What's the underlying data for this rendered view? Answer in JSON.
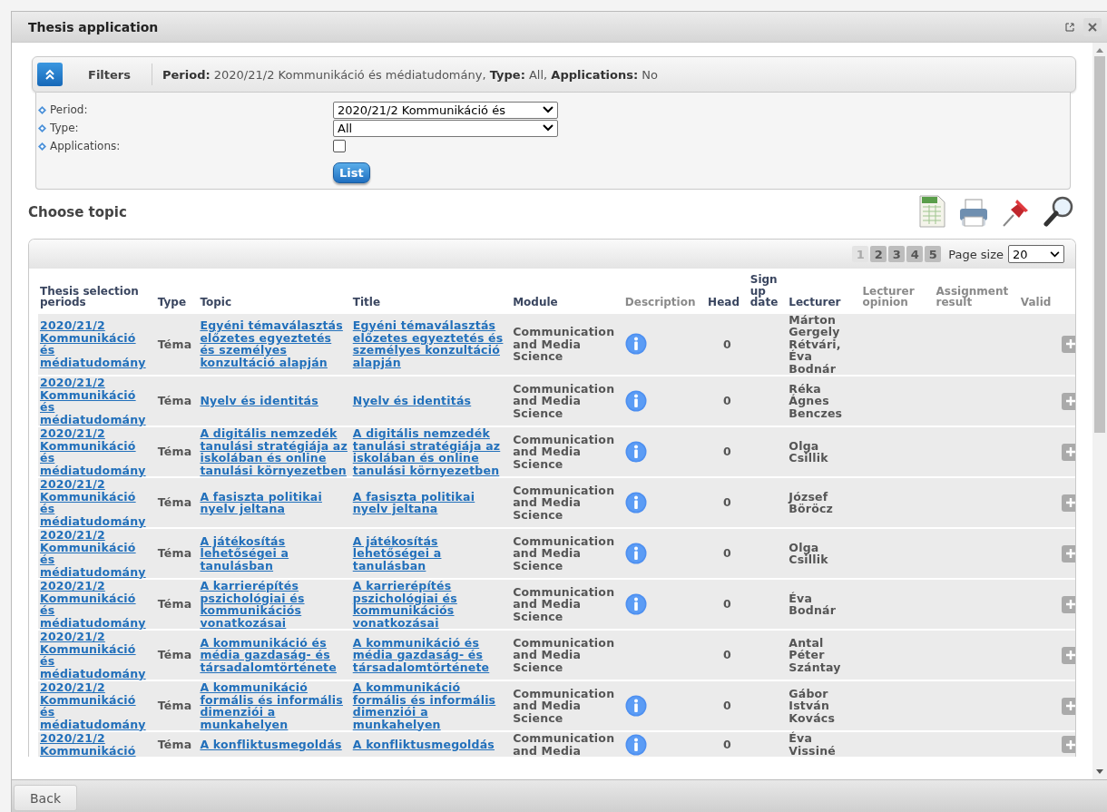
{
  "window": {
    "title": "Thesis application"
  },
  "filters": {
    "label": "Filters",
    "expanded": true,
    "summary": "**Period:** 2020/21/2 Kommunikáció és médiatudomány, **Type:** All, **Applications:** No",
    "fields": [
      {
        "kind": "select",
        "label": "Period:",
        "value": "2020/21/2 Kommunikáció és"
      },
      {
        "kind": "select",
        "label": "Type:",
        "value": "All"
      },
      {
        "kind": "checkbox",
        "label": "Applications:",
        "checked": false
      }
    ],
    "list_button": "List"
  },
  "section_title": "Choose topic",
  "pagination": {
    "pages": [
      {
        "label": "1",
        "selected": true
      },
      {
        "label": "2",
        "selected": false
      },
      {
        "label": "3",
        "selected": false
      },
      {
        "label": "4",
        "selected": false
      },
      {
        "label": "5",
        "selected": false
      }
    ],
    "page_size_label": "Page size",
    "page_size": "20"
  },
  "table": {
    "columns": [
      {
        "label": "Thesis selection periods",
        "muted": false
      },
      {
        "label": "Type",
        "muted": false
      },
      {
        "label": "Topic",
        "muted": false
      },
      {
        "label": "Title",
        "muted": false
      },
      {
        "label": "Module",
        "muted": false
      },
      {
        "label": "Description",
        "muted": true
      },
      {
        "label": "Head",
        "muted": false
      },
      {
        "label": "Sign up date",
        "muted": false
      },
      {
        "label": "Lecturer",
        "muted": false
      },
      {
        "label": "Lecturer opinion",
        "muted": true
      },
      {
        "label": "Assignment result",
        "muted": true
      },
      {
        "label": "Valid",
        "muted": true
      }
    ],
    "rows": [
      {
        "period": "2020/21/2 Kommunikáció és médiatudomány",
        "type": "Téma",
        "topic": "Egyéni témaválasztás előzetes egyeztetés és személyes konzultáció alapján",
        "title": "Egyéni témaválasztás előzetes egyeztetés és személyes konzultáció alapján",
        "module": "Communication and Media Science",
        "description": true,
        "head": "0",
        "lecturer": "Márton Gergely Rétvári, Éva Bodnár"
      },
      {
        "period": "2020/21/2 Kommunikáció és médiatudomány",
        "type": "Téma",
        "topic": "Nyelv és identitás",
        "title": "Nyelv és identitás",
        "module": "Communication and Media Science",
        "description": true,
        "head": "0",
        "lecturer": "Réka Ágnes Benczes"
      },
      {
        "period": "2020/21/2 Kommunikáció és médiatudomány",
        "type": "Téma",
        "topic": "A digitális nemzedék tanulási stratégiája az iskolában és online tanulási környezetben",
        "title": "A digitális nemzedék tanulási stratégiája az iskolában és online tanulási környezetben",
        "module": "Communication and Media Science",
        "description": true,
        "head": "0",
        "lecturer": "Olga Csillik"
      },
      {
        "period": "2020/21/2 Kommunikáció és médiatudomány",
        "type": "Téma",
        "topic": "A fasiszta politikai nyelv jeltana",
        "title": "A fasiszta politikai nyelv jeltana",
        "module": "Communication and Media Science",
        "description": true,
        "head": "0",
        "lecturer": "József Böröcz"
      },
      {
        "period": "2020/21/2 Kommunikáció és médiatudomány",
        "type": "Téma",
        "topic": "A játékosítás lehetőségei a tanulásban",
        "title": "A játékosítás lehetőségei a tanulásban",
        "module": "Communication and Media Science",
        "description": true,
        "head": "0",
        "lecturer": "Olga Csillik"
      },
      {
        "period": "2020/21/2 Kommunikáció és médiatudomány",
        "type": "Téma",
        "topic": "A karrierépítés pszichológiai és kommunikációs vonatkozásai",
        "title": "A karrierépítés pszichológiai és kommunikációs vonatkozásai",
        "module": "Communication and Media Science",
        "description": true,
        "head": "0",
        "lecturer": "Éva Bodnár"
      },
      {
        "period": "2020/21/2 Kommunikáció és médiatudomány",
        "type": "Téma",
        "topic": "A kommunikáció és média gazdaság- és társadalomtörténete",
        "title": "A kommunikáció és média gazdaság- és társadalomtörténete",
        "module": "Communication and Media Science",
        "description": false,
        "head": "0",
        "lecturer": "Antal Péter Szántay"
      },
      {
        "period": "2020/21/2 Kommunikáció és médiatudomány",
        "type": "Téma",
        "topic": "A kommunikáció formális és informális dimenziói a munkahelyen",
        "title": "A kommunikáció formális és informális dimenziói a munkahelyen",
        "module": "Communication and Media Science",
        "description": true,
        "head": "0",
        "lecturer": "Gábor István Kovács"
      },
      {
        "period": "2020/21/2 Kommunikáció",
        "type": "Téma",
        "topic": "A konfliktusmegoldás",
        "title": "A konfliktusmegoldás",
        "module": "Communication and Media",
        "description": true,
        "head": "0",
        "lecturer": "Éva Vissiné"
      }
    ]
  },
  "back_button": "Back"
}
